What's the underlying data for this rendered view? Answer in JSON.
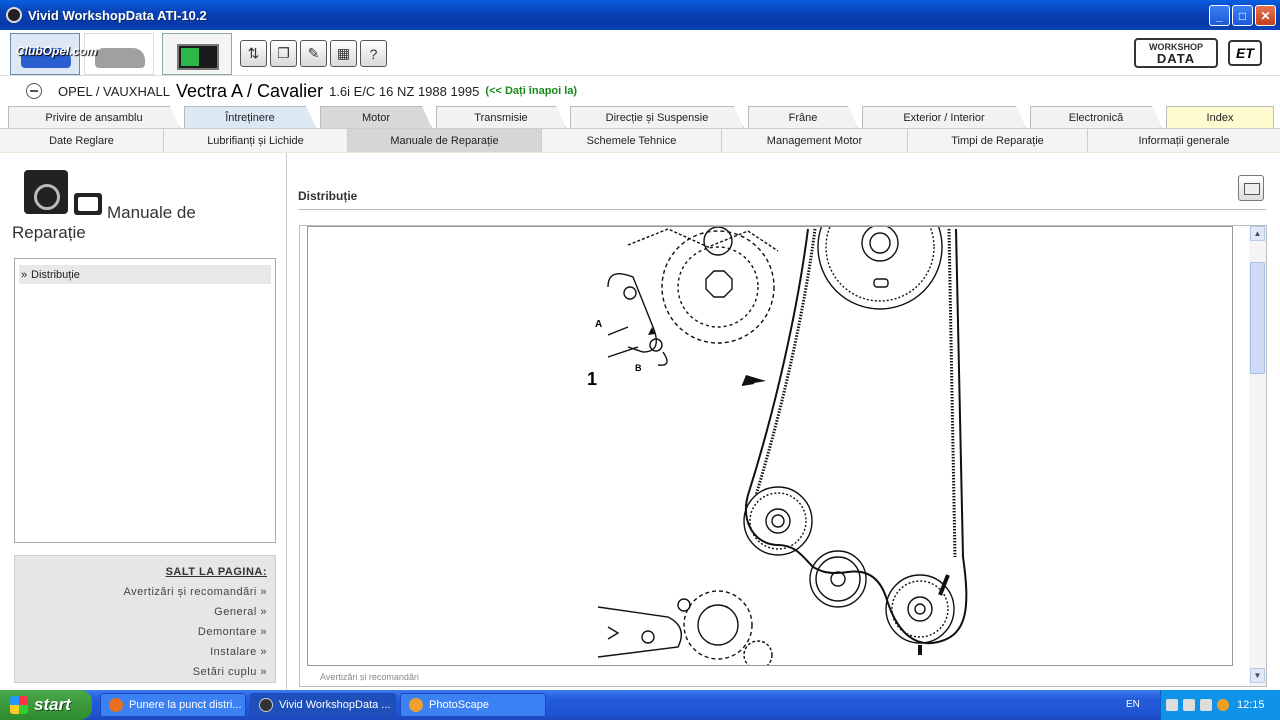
{
  "window": {
    "title": "Vivid WorkshopData ATI-10.2"
  },
  "toolbar": {
    "watermark": "ClubOpel.com",
    "brand_top": "WORKSHOP",
    "brand_main": "DATA",
    "brand2": "ET"
  },
  "vehicle": {
    "make": "OPEL / VAUXHALL",
    "model": "Vectra A / Cavalier",
    "spec": "1.6i E/C 16 NZ 1988 1995",
    "back_link": "(<< Dați înapoi la)"
  },
  "main_tabs": [
    {
      "label": "Privire de ansamblu"
    },
    {
      "label": "Întreținere"
    },
    {
      "label": "Motor"
    },
    {
      "label": "Transmisie"
    },
    {
      "label": "Direcție și Suspensie"
    },
    {
      "label": "Frâne"
    },
    {
      "label": "Exterior / Interior"
    },
    {
      "label": "Electronică"
    },
    {
      "label": "Index"
    }
  ],
  "sub_tabs": [
    {
      "label": "Date Reglare"
    },
    {
      "label": "Lubrifianți și Lichide"
    },
    {
      "label": "Manuale de Reparație"
    },
    {
      "label": "Schemele Tehnice"
    },
    {
      "label": "Management Motor"
    },
    {
      "label": "Timpi de Reparație"
    },
    {
      "label": "Informații generale"
    }
  ],
  "sidebar": {
    "title": "Manuale de Reparație",
    "items": [
      {
        "label": "Distribuție"
      }
    ],
    "jump": {
      "header": "SALT LA PAGINA:",
      "links": [
        {
          "label": "Avertizări și recomandări"
        },
        {
          "label": "General"
        },
        {
          "label": "Demontare"
        },
        {
          "label": "Instalare"
        },
        {
          "label": "Setări cuplu"
        }
      ]
    }
  },
  "content": {
    "title": "Distribuție",
    "diagram": {
      "label_1": "1",
      "label_a": "A",
      "label_b": "B"
    },
    "cutoff_text": "Avertizări și recomandări"
  },
  "taskbar": {
    "start": "start",
    "tasks": [
      {
        "label": "Punere la punct distri..."
      },
      {
        "label": "Vivid WorkshopData ..."
      },
      {
        "label": "PhotoScape"
      }
    ],
    "lang": "EN",
    "clock": "12:15"
  }
}
